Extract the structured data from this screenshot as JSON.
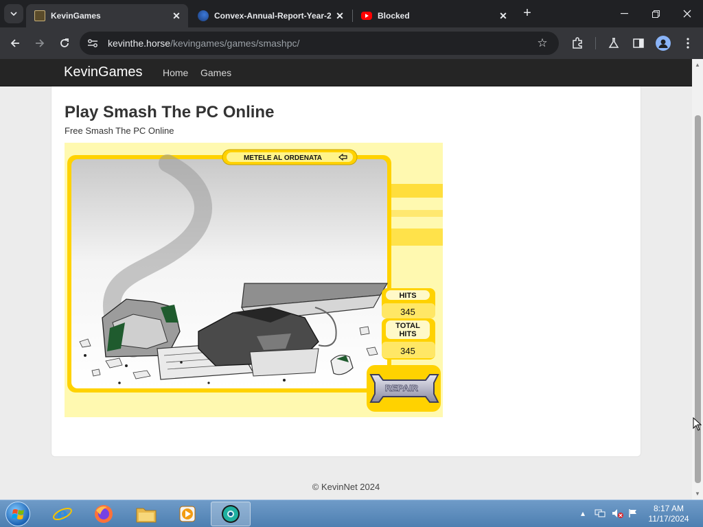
{
  "browser": {
    "tabs": [
      {
        "title": "KevinGames",
        "active": true,
        "favicon": "kevingames-favicon"
      },
      {
        "title": "Convex-Annual-Report-Year-2",
        "active": false,
        "favicon": "convex-favicon"
      },
      {
        "title": "Blocked",
        "active": false,
        "favicon": "youtube-favicon"
      }
    ],
    "url_host": "kevinthe.horse",
    "url_path": "/kevingames/games/smashpc/",
    "accent": "#35363a"
  },
  "site": {
    "brand": "KevinGames",
    "nav": [
      "Home",
      "Games"
    ],
    "page_title": "Play Smash The PC Online",
    "page_subtitle": "Free Smash The PC Online",
    "footer": "© KevinNet 2024"
  },
  "game": {
    "banner": "METELE AL ORDENATA",
    "hits_label": "HITS",
    "hits_value": "345",
    "total_hits_label_1": "TOTAL",
    "total_hits_label_2": "HITS",
    "total_hits_value": "345",
    "repair_label": "REPAIR",
    "colors": {
      "yellow": "#ffd200",
      "panel": "#fff9b0"
    }
  },
  "taskbar": {
    "apps": [
      "internet-explorer-icon",
      "firefox-icon",
      "file-explorer-icon",
      "media-player-icon",
      "chrome-icon"
    ],
    "clock_time": "8:17 AM",
    "clock_date": "11/17/2024"
  }
}
